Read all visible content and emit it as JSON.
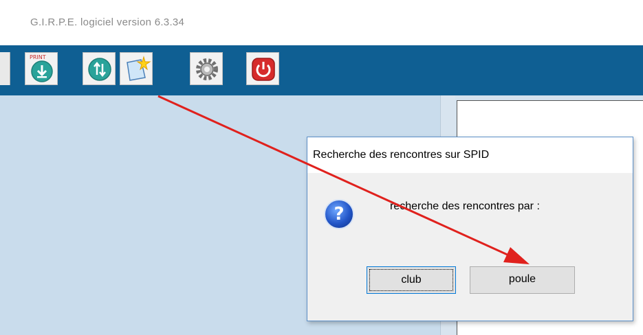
{
  "app": {
    "title": "G.I.R.P.E.   logiciel version  6.3.34"
  },
  "toolbar": {
    "buttons": [
      {
        "icon": "download-icon",
        "color": "#2aa39a"
      },
      {
        "icon": "sync-icon",
        "color": "#2aa39a"
      },
      {
        "icon": "new-document-icon",
        "color": "#f5c400"
      },
      {
        "icon": "gear-icon",
        "color": "#8a8a8a"
      },
      {
        "icon": "power-icon",
        "color": "#d62b2b"
      }
    ],
    "background": "#0f5f93"
  },
  "dialog": {
    "title": "Recherche des rencontres sur SPID",
    "message": "recherche des rencontres par :",
    "buttons": {
      "club": "club",
      "poule": "poule"
    }
  },
  "annotation": {
    "arrow_color": "#e0211d"
  }
}
